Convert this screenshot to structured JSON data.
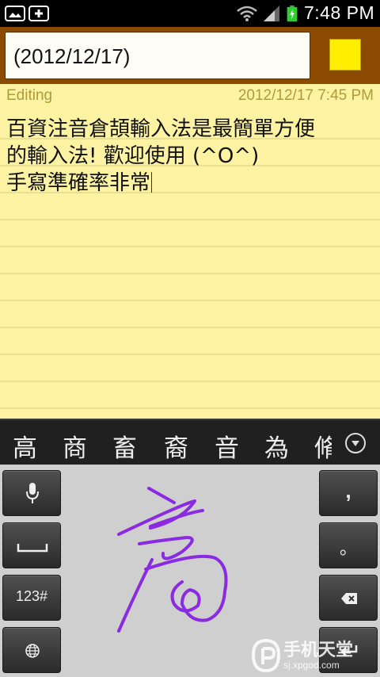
{
  "status_bar": {
    "time": "7:48 PM",
    "icons": [
      "image-notification-icon",
      "add-notification-icon",
      "wifi-icon",
      "signal-icon",
      "battery-charging-icon"
    ]
  },
  "header": {
    "title_value": "(2012/12/17)",
    "note_color": "#ffee00",
    "header_color": "#8a4a00"
  },
  "note": {
    "status": "Editing",
    "date": "2012/12/17 7:45 PM",
    "lines": [
      "百資注音倉頡輸入法是最簡單方便",
      "的輸入法! 歡迎使用 (^O^)",
      "手寫準確率非常"
    ],
    "paper_color": "#fdf3a2"
  },
  "candidates": {
    "items": [
      "高",
      "商",
      "畜",
      "裔",
      "音",
      "為",
      "脩"
    ],
    "expand_icon": "chevron-down-circle-icon"
  },
  "keyboard": {
    "mic_icon": "microphone-icon",
    "space_icon": "space-bar-icon",
    "mode_label": "123#",
    "globe_icon": "language-icon",
    "comma_label": ",",
    "period_label": "。",
    "backspace_icon": "backspace-icon",
    "enter_icon": "enter-icon",
    "stroke_color": "#8a2be2"
  },
  "watermark": {
    "title": "手机天堂",
    "subtitle": "sj.xpgod.com"
  }
}
